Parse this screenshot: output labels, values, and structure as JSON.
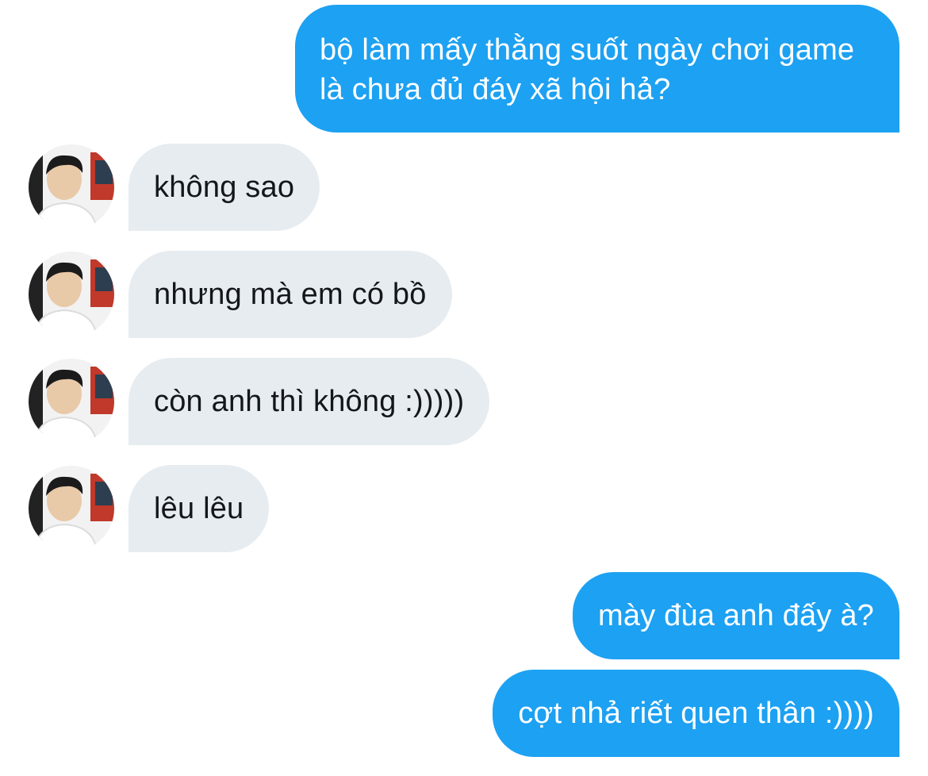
{
  "messages": [
    {
      "from": "me",
      "text": "bộ làm mấy thằng suốt ngày chơi game là chưa đủ đáy xã hội hả?"
    },
    {
      "from": "them",
      "text": "không sao"
    },
    {
      "from": "them",
      "text": "nhưng mà em có bồ"
    },
    {
      "from": "them",
      "text": "còn anh thì không :)))))"
    },
    {
      "from": "them",
      "text": "lêu lêu"
    },
    {
      "from": "me",
      "text": "mày đùa anh đấy à?"
    },
    {
      "from": "me",
      "text": "cợt nhả riết quen thân :))))"
    }
  ],
  "colors": {
    "sent_bubble": "#1da1f2",
    "received_bubble": "#e6ecf0",
    "received_text": "#14171a"
  },
  "avatar": {
    "icon": "profile-photo-icon"
  }
}
